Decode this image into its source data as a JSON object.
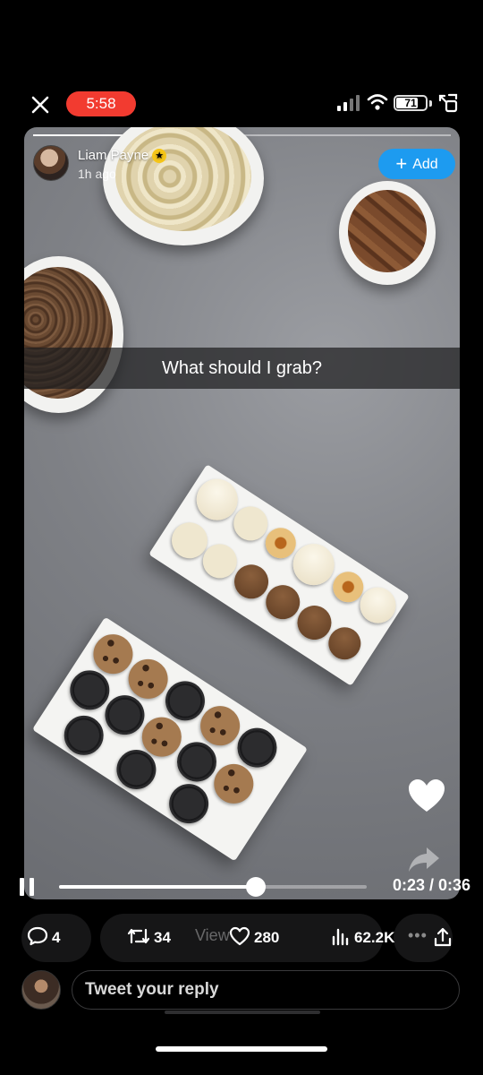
{
  "status_bar": {
    "time": "5:58",
    "battery": "71",
    "time_pill_color": "#f23b30"
  },
  "story": {
    "username": "Liam Payne",
    "time_ago": "1h ago",
    "add_label": "Add",
    "caption": "What should I grab?",
    "story_progress": 0.42
  },
  "video": {
    "current_time": "0:23",
    "duration": "0:36",
    "time_readout": "0:23 / 0:36",
    "progress": 0.639
  },
  "actions": {
    "replies": "4",
    "reposts": "34",
    "likes": "280",
    "views": "62.2K",
    "ghost_text": "View"
  },
  "reply": {
    "placeholder": "Tweet your reply"
  },
  "colors": {
    "accent": "#1d9bf0",
    "background": "#000000"
  },
  "icons": [
    "close-icon",
    "signal-icon",
    "wifi-icon",
    "battery-icon",
    "rotate-icon",
    "verified-icon",
    "plus-icon",
    "heart-icon",
    "share-icon",
    "pause-icon",
    "reply-icon",
    "repost-icon",
    "like-icon",
    "views-icon",
    "upload-icon"
  ]
}
